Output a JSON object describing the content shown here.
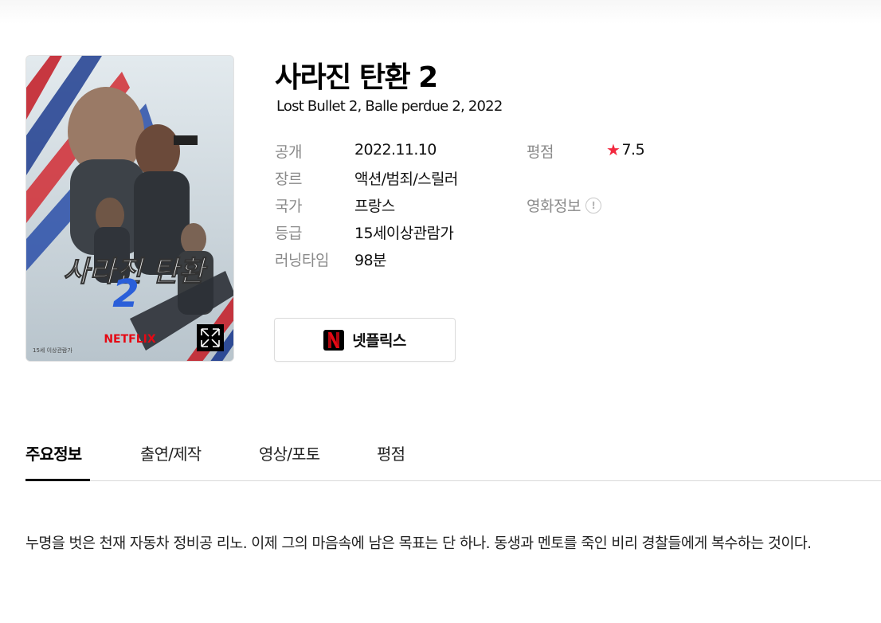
{
  "movie": {
    "title": "사라진 탄환 2",
    "subtitle": "Lost Bullet 2, Balle perdue 2, 2022",
    "poster": {
      "title_text": "사라진 탄환",
      "number_text": "2",
      "brand_text": "NETFLIX",
      "rating_text": "15세 이상관람가"
    }
  },
  "info": {
    "release_label": "공개",
    "release_value": "2022.11.10",
    "genre_label": "장르",
    "genre_value": "액션/범죄/스릴러",
    "country_label": "국가",
    "country_value": "프랑스",
    "grade_label": "등급",
    "grade_value": "15세이상관람가",
    "runtime_label": "러닝타임",
    "runtime_value": "98분",
    "rating_label": "평점",
    "rating_value": "7.5",
    "movie_info_label": "영화정보"
  },
  "ott": {
    "label": "넷플릭스",
    "logo_letter": "N"
  },
  "tabs": [
    {
      "label": "주요정보",
      "active": true
    },
    {
      "label": "출연/제작",
      "active": false
    },
    {
      "label": "영상/포토",
      "active": false
    },
    {
      "label": "평점",
      "active": false
    }
  ],
  "synopsis": "누명을 벗은 천재 자동차 정비공 리노. 이제 그의 마음속에 남은 목표는 단 하나. 동생과 멘토를 죽인 비리 경찰들에게 복수하는 것이다.",
  "colors": {
    "star": "#f2283e",
    "netflix_red": "#e50914",
    "active_tab": "#000000",
    "label_gray": "#8a8a8a"
  },
  "icons": {
    "expand": "expand-icon",
    "star": "star-icon",
    "info": "info-icon",
    "netflix": "netflix-logo-icon"
  }
}
